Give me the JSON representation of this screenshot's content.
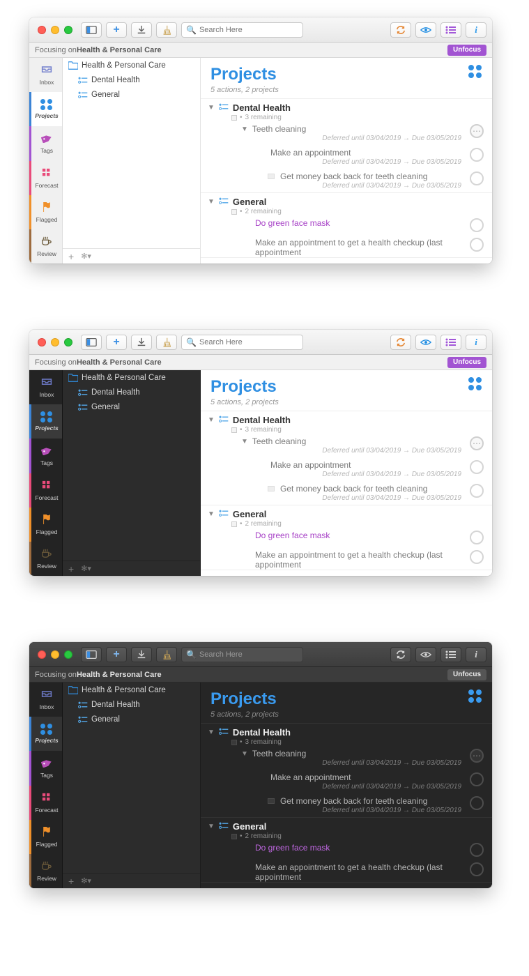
{
  "search_placeholder": "Search Here",
  "focus": {
    "prefix": "Focusing on ",
    "target": "Health & Personal Care",
    "unfocus": "Unfocus"
  },
  "perspectives": [
    {
      "id": "inbox",
      "label": "Inbox"
    },
    {
      "id": "projects",
      "label": "Projects"
    },
    {
      "id": "tags",
      "label": "Tags"
    },
    {
      "id": "forecast",
      "label": "Forecast"
    },
    {
      "id": "flagged",
      "label": "Flagged"
    },
    {
      "id": "review",
      "label": "Review"
    }
  ],
  "outline": {
    "folder": "Health & Personal Care",
    "items": [
      "Dental Health",
      "General"
    ]
  },
  "main": {
    "title": "Projects",
    "subtitle": "5 actions, 2 projects",
    "projects": [
      {
        "title": "Dental Health",
        "remaining": "3 remaining",
        "tasks": [
          {
            "title": "Teeth cleaning",
            "dates": "Deferred until 03/04/2019 → Due 03/05/2019",
            "group": true
          },
          {
            "title": "Make an appointment",
            "dates": "Deferred until 03/04/2019 → Due 03/05/2019"
          },
          {
            "title": "Get money back back for teeth cleaning",
            "dates": "Deferred until 03/04/2019 → Due 03/05/2019",
            "note": true
          }
        ]
      },
      {
        "title": "General",
        "remaining": "2 remaining",
        "tasks": [
          {
            "title": "Do green face mask",
            "purple": true
          },
          {
            "title": "Make an appointment to get a health checkup (last appointment",
            "cut": true
          }
        ]
      }
    ]
  }
}
